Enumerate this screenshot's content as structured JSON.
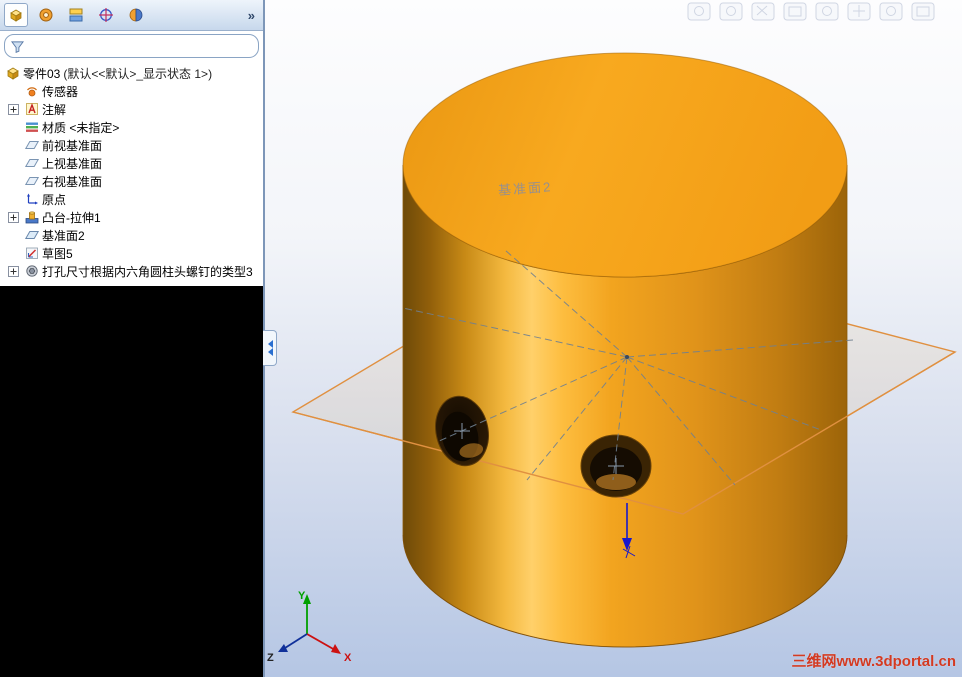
{
  "left_panel": {
    "toolbar": {
      "overflow_label": "»"
    },
    "filter": {
      "value": ""
    },
    "tree": {
      "root_label": "零件03",
      "root_config": "(默认<<默认>_显示状态 1>)",
      "items": [
        {
          "label": "传感器"
        },
        {
          "label": "注解"
        },
        {
          "label": "材质 <未指定>"
        },
        {
          "label": "前视基准面"
        },
        {
          "label": "上视基准面"
        },
        {
          "label": "右视基准面"
        },
        {
          "label": "原点"
        },
        {
          "label": "凸台-拉伸1"
        },
        {
          "label": "基准面2"
        },
        {
          "label": "草图5"
        },
        {
          "label": "打孔尺寸根据内六角圆柱头螺钉的类型3"
        }
      ]
    }
  },
  "viewport": {
    "plane_label": "基准面2",
    "triad": {
      "x": "X",
      "y": "Y",
      "z": "Z"
    },
    "watermark": "三维网www.3dportal.cn",
    "colors": {
      "model_orange": "#f6a41d",
      "plane_edge": "#e09040",
      "axis_x": "#cc1111",
      "axis_y": "#009900",
      "axis_z": "#10309a",
      "watermark_red": "#d33a22"
    }
  }
}
